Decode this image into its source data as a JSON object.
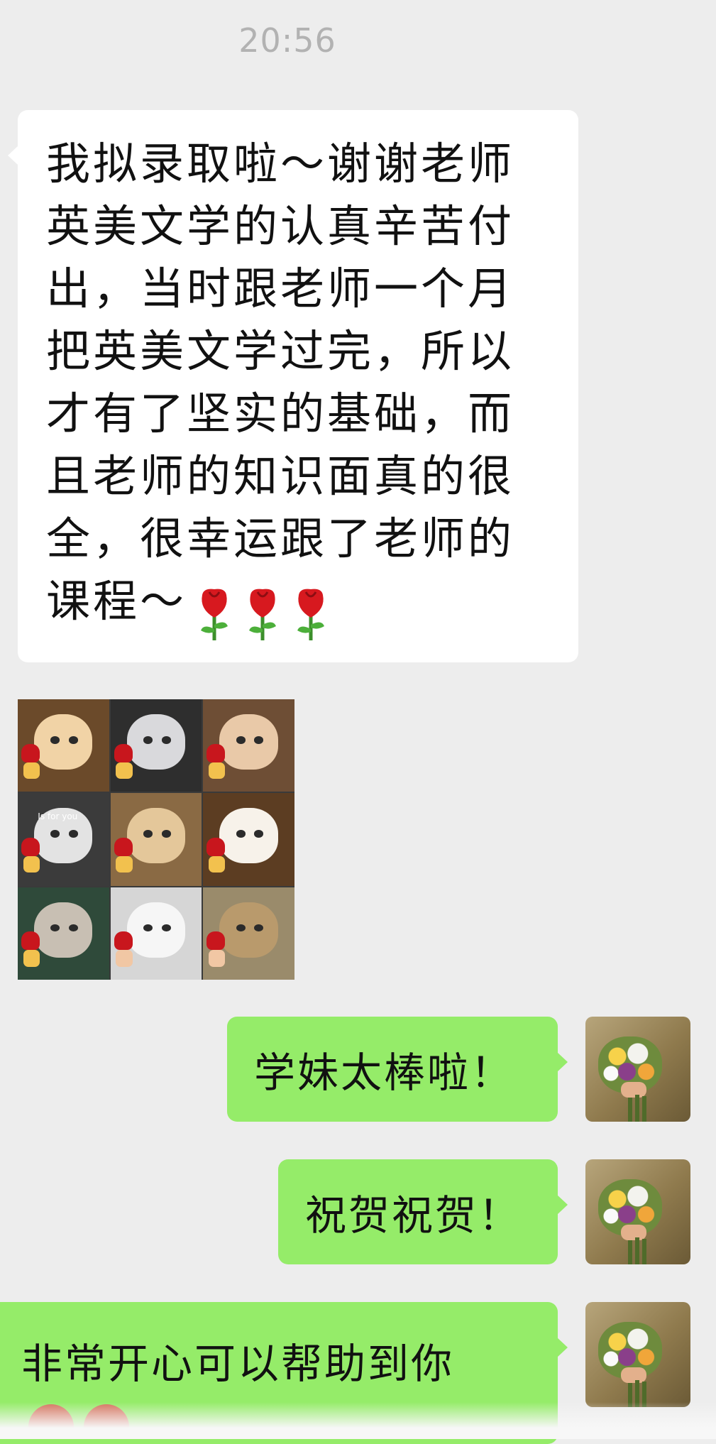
{
  "chat": {
    "timestamp": "20:56",
    "messages": {
      "incoming": {
        "text": "我拟录取啦～谢谢老师英美文学的认真辛苦付出，当时跟老师一个月把英美文学过完，所以才有了坚实的基础，而且老师的知识面真的很全，很幸运跟了老师的课程～",
        "emoji": [
          "rose-emoji",
          "rose-emoji",
          "rose-emoji"
        ]
      },
      "sticker": {
        "icon": "cats-with-roses-sticker",
        "caption": "Is for you"
      },
      "outgoing": [
        {
          "text": "学妹太棒啦！"
        },
        {
          "text": "祝贺祝贺！"
        },
        {
          "text": "非常开心可以帮助到你"
        }
      ]
    }
  },
  "colors": {
    "background": "#ededed",
    "incoming_bubble": "#ffffff",
    "outgoing_bubble": "#95ec69",
    "timestamp": "#b2b2b2",
    "rose": "#d7191f"
  }
}
